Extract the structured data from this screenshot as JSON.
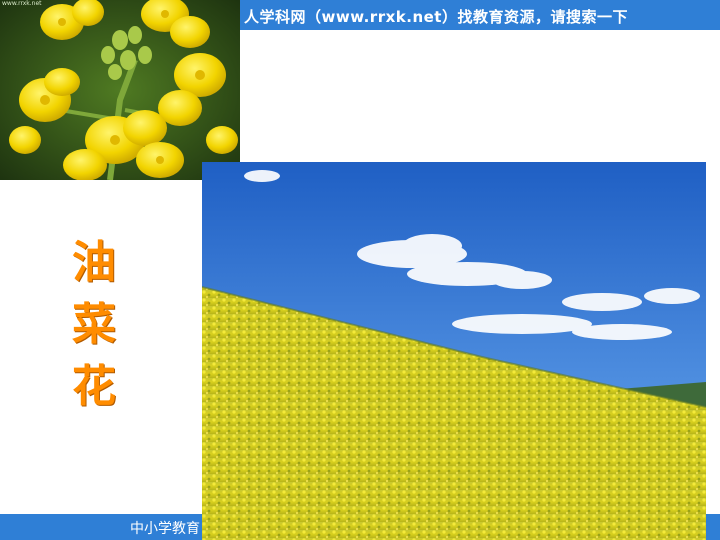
{
  "header": {
    "banner_text": "人学科网（www.rrxk.net）找教育资源，请搜索一下"
  },
  "footer": {
    "banner_text": "中小学教育"
  },
  "slide": {
    "title_chars": [
      "油",
      "菜",
      "花"
    ]
  },
  "photos": {
    "flower_caption": "www.rrxk.net"
  },
  "colors": {
    "banner": "#2f7fd6",
    "title": "#ff8c00"
  }
}
